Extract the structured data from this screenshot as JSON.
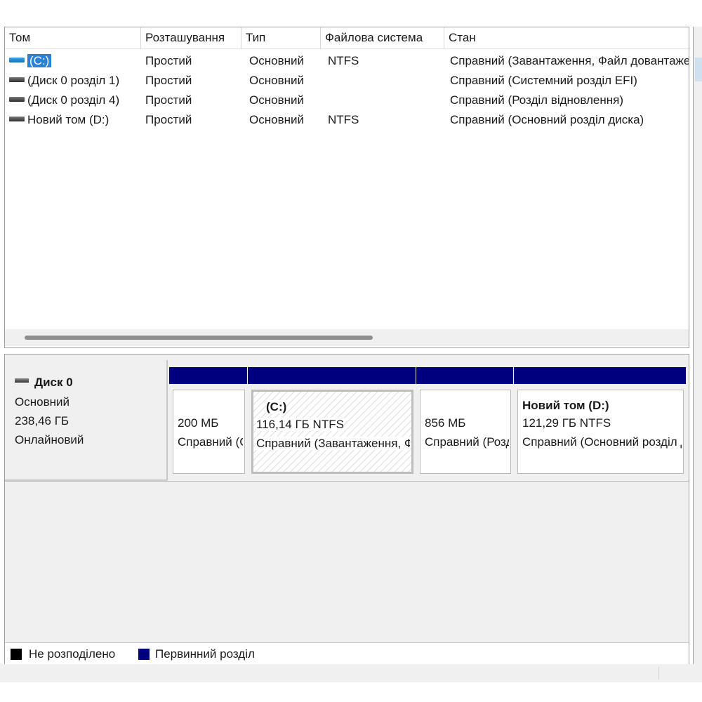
{
  "volume_list": {
    "columns": [
      "Том",
      "Розташування",
      "Тип",
      "Файлова система",
      "Стан"
    ],
    "rows": [
      {
        "name": "(C:)",
        "layout": "Простий",
        "type": "Основний",
        "fs": "NTFS",
        "status": "Справний (Завантаження, Файл довантаження"
      },
      {
        "name": "(Диск 0 розділ 1)",
        "layout": "Простий",
        "type": "Основний",
        "fs": "",
        "status": "Справний (Системний розділ EFI)"
      },
      {
        "name": "(Диск 0 розділ 4)",
        "layout": "Простий",
        "type": "Основний",
        "fs": "",
        "status": "Справний (Розділ відновлення)"
      },
      {
        "name": "Новий том (D:)",
        "layout": "Простий",
        "type": "Основний",
        "fs": "NTFS",
        "status": "Справний (Основний розділ диска)"
      }
    ],
    "selected_row": 0
  },
  "disk": {
    "name": "Диск 0",
    "type": "Основний",
    "size": "238,46 ГБ",
    "state": "Онлайновий"
  },
  "partitions": [
    {
      "label": "",
      "size": "200 МБ",
      "status": "Справний (Системний розділ EFI)",
      "selected": false
    },
    {
      "label": "(C:)",
      "size": "116,14 ГБ NTFS",
      "status": "Справний (Завантаження, Файл довантаження",
      "selected": true
    },
    {
      "label": "",
      "size": "856 МБ",
      "status": "Справний (Розділ відновлення)",
      "selected": false
    },
    {
      "label": "Новий том  (D:)",
      "size": "121,29 ГБ NTFS",
      "status": "Справний (Основний розділ диска)",
      "selected": false
    }
  ],
  "legend": {
    "unallocated": "Не розподілено",
    "primary": "Первинний розділ",
    "unallocated_color": "#000000",
    "primary_color": "#00007f"
  },
  "icons": {
    "volume": "drive-icon",
    "disk": "disk-icon"
  }
}
